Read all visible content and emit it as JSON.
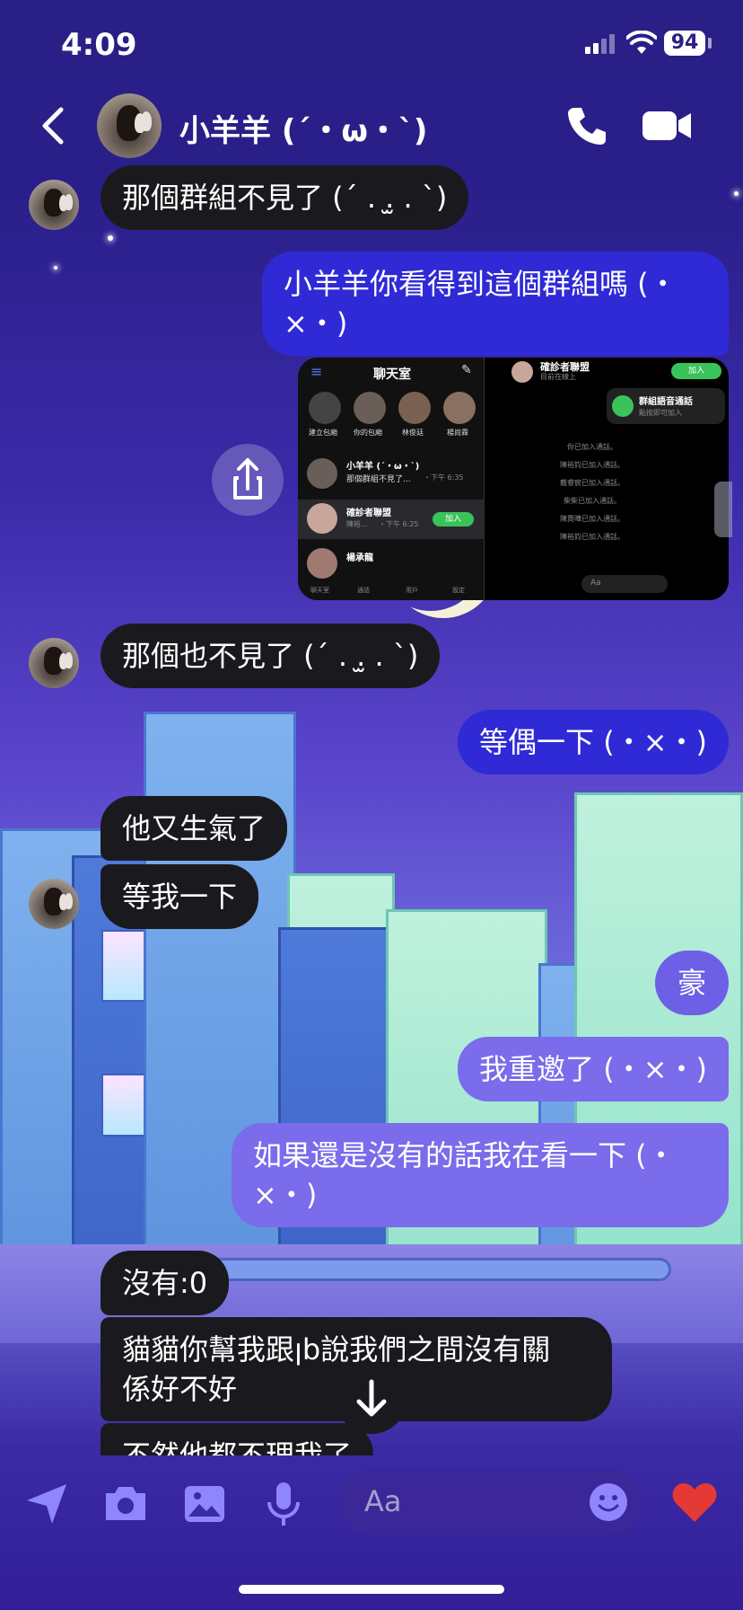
{
  "status_bar": {
    "time": "4:09",
    "battery": "94"
  },
  "header": {
    "contact_name": "小羊羊 (´・ω・`)"
  },
  "messages": [
    {
      "text": "那個群組不見了 (´ . .̫ . `)"
    },
    {
      "text_line1": "小羊羊你看得到這個群組嗎 (・",
      "text_line2": "×・)"
    },
    {
      "text": "那個也不見了 (´ . .̫ . `)"
    },
    {
      "text": "等偶一下 (・×・)"
    },
    {
      "text": "他又生氣了"
    },
    {
      "text": "等我一下"
    },
    {
      "text": "豪"
    },
    {
      "text": "我重邀了 (・×・)"
    },
    {
      "text_line1": "如果還是沒有的話我在看一下 (・",
      "text_line2": "×・)"
    },
    {
      "text": "沒有:0"
    },
    {
      "text_line1": "貓貓你幫我跟ꞁb說我們之間沒有關",
      "text_line2": "係好不好"
    },
    {
      "text": "不然他都不理我了"
    }
  ],
  "shared_image": {
    "left": {
      "title": "聊天室",
      "stories": [
        "建立包廂",
        "你的包廂",
        "林俊廷",
        "楊尚霖"
      ],
      "chats": [
        {
          "name": "小羊羊 (´・ω・`)",
          "preview": "那個群組不見了...",
          "time": "・下午 6:35"
        },
        {
          "name": "確診者聯盟",
          "preview": "陳裕...",
          "time": "・下午 6:25",
          "action": "加入"
        },
        {
          "name": "楊承龍",
          "preview": "",
          "time": ""
        }
      ],
      "tabs": [
        "聊天室",
        "通話",
        "用戶",
        "設定"
      ]
    },
    "right": {
      "group_name": "確診者聯盟",
      "group_status": "目前在線上",
      "join_label": "加入",
      "call_title": "群組語音通話",
      "call_sub": "點按即可加入",
      "events": [
        "你已加入通話。",
        "陳裕鈞已加入通話。",
        "戴睿宸已加入通話。",
        "柴柴已加入通話。",
        "陳賈曄已加入通話。",
        "陳裕鈞已加入通話。"
      ],
      "input_placeholder": "Aa"
    }
  },
  "composer": {
    "placeholder": "Aa"
  },
  "colors": {
    "sent_bubble": "#2f2ad6",
    "sent_bubble_light": "#6d5fe6",
    "received_bubble": "#1a1a1e",
    "background_top": "#2a1f86",
    "background_mid": "#6a62d8",
    "heart": "#e53935"
  },
  "icons": [
    "back-chevron-icon",
    "phone-icon",
    "video-camera-icon",
    "share-icon",
    "scroll-down-arrow-icon",
    "send-location-icon",
    "camera-icon",
    "gallery-icon",
    "microphone-icon",
    "emoji-icon",
    "heart-icon"
  ]
}
